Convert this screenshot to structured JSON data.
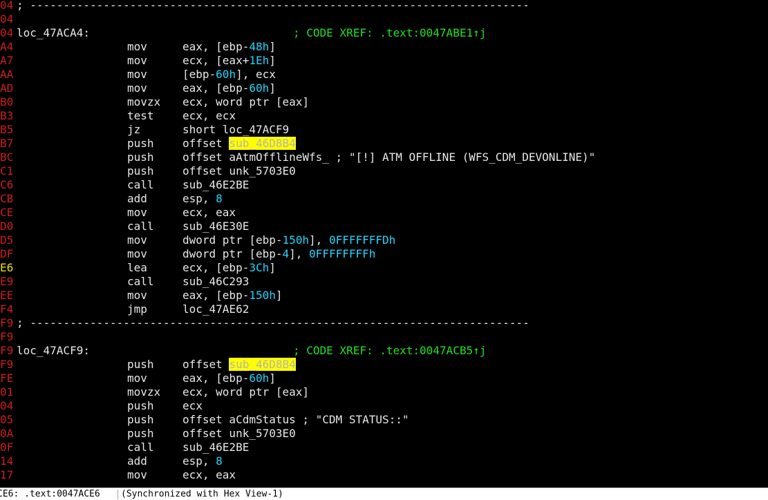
{
  "colors": {
    "background": "#000000",
    "address": "#cc1e1e",
    "current_address": "#f0e000",
    "text": "#e8e8e8",
    "xref_comment": "#22e022",
    "number": "#22d6ff",
    "highlight": "#ffff00"
  },
  "lines": [
    {
      "kind": "sep",
      "addr": "04",
      "text": "; ---------------------------------------------------------------------------"
    },
    {
      "kind": "blank",
      "addr": "04"
    },
    {
      "kind": "label",
      "addr": "04",
      "label": "loc_47ACA4:",
      "xref": "; CODE XREF: .text:0047ABE1↑j"
    },
    {
      "kind": "ins",
      "addr": "A4",
      "mnem": "mov",
      "ops": [
        {
          "t": "eax, [ebp-"
        },
        {
          "t": "48h",
          "c": "n"
        },
        {
          "t": "]"
        }
      ]
    },
    {
      "kind": "ins",
      "addr": "A7",
      "mnem": "mov",
      "ops": [
        {
          "t": "ecx, [eax+"
        },
        {
          "t": "1Eh",
          "c": "n"
        },
        {
          "t": "]"
        }
      ]
    },
    {
      "kind": "ins",
      "addr": "AA",
      "mnem": "mov",
      "ops": [
        {
          "t": "[ebp-"
        },
        {
          "t": "60h",
          "c": "n"
        },
        {
          "t": "], ecx"
        }
      ]
    },
    {
      "kind": "ins",
      "addr": "AD",
      "mnem": "mov",
      "ops": [
        {
          "t": "eax, [ebp-"
        },
        {
          "t": "60h",
          "c": "n"
        },
        {
          "t": "]"
        }
      ]
    },
    {
      "kind": "ins",
      "addr": "B0",
      "mnem": "movzx",
      "ops": [
        {
          "t": "ecx, word ptr [eax]"
        }
      ]
    },
    {
      "kind": "ins",
      "addr": "B3",
      "mnem": "test",
      "ops": [
        {
          "t": "ecx, ecx"
        }
      ]
    },
    {
      "kind": "ins",
      "addr": "B5",
      "mnem": "jz",
      "ops": [
        {
          "t": "short loc_47ACF9"
        }
      ]
    },
    {
      "kind": "ins",
      "addr": "B7",
      "mnem": "push",
      "ops": [
        {
          "t": "offset "
        },
        {
          "t": "sub_46D8B4",
          "c": "hl"
        }
      ]
    },
    {
      "kind": "ins",
      "addr": "BC",
      "mnem": "push",
      "ops": [
        {
          "t": "offset aAtmOfflineWfs_ ; \"[!] ATM OFFLINE (WFS_CDM_DEVONLINE)\""
        }
      ]
    },
    {
      "kind": "ins",
      "addr": "C1",
      "mnem": "push",
      "ops": [
        {
          "t": "offset unk_5703E0"
        }
      ]
    },
    {
      "kind": "ins",
      "addr": "C6",
      "mnem": "call",
      "ops": [
        {
          "t": "sub_46E2BE"
        }
      ]
    },
    {
      "kind": "ins",
      "addr": "CB",
      "mnem": "add",
      "ops": [
        {
          "t": "esp, "
        },
        {
          "t": "8",
          "c": "n"
        }
      ]
    },
    {
      "kind": "ins",
      "addr": "CE",
      "mnem": "mov",
      "ops": [
        {
          "t": "ecx, eax"
        }
      ]
    },
    {
      "kind": "ins",
      "addr": "D0",
      "mnem": "call",
      "ops": [
        {
          "t": "sub_46E30E"
        }
      ]
    },
    {
      "kind": "ins",
      "addr": "D5",
      "mnem": "mov",
      "ops": [
        {
          "t": "dword ptr [ebp-"
        },
        {
          "t": "150h",
          "c": "n"
        },
        {
          "t": "], "
        },
        {
          "t": "0FFFFFFFDh",
          "c": "n"
        }
      ]
    },
    {
      "kind": "ins",
      "addr": "DF",
      "mnem": "mov",
      "ops": [
        {
          "t": "dword ptr [ebp-"
        },
        {
          "t": "4",
          "c": "n"
        },
        {
          "t": "], "
        },
        {
          "t": "0FFFFFFFFh",
          "c": "n"
        }
      ]
    },
    {
      "kind": "ins",
      "addr": "E6",
      "cur": true,
      "mnem": "lea",
      "ops": [
        {
          "t": "ecx, [ebp-"
        },
        {
          "t": "3Ch",
          "c": "n"
        },
        {
          "t": "]"
        }
      ]
    },
    {
      "kind": "ins",
      "addr": "E9",
      "mnem": "call",
      "ops": [
        {
          "t": "sub_46C293"
        }
      ]
    },
    {
      "kind": "ins",
      "addr": "EE",
      "mnem": "mov",
      "ops": [
        {
          "t": "eax, [ebp-"
        },
        {
          "t": "150h",
          "c": "n"
        },
        {
          "t": "]"
        }
      ]
    },
    {
      "kind": "ins",
      "addr": "F4",
      "mnem": "jmp",
      "ops": [
        {
          "t": "loc_47AE62"
        }
      ]
    },
    {
      "kind": "sep",
      "addr": "F9",
      "text": "; ---------------------------------------------------------------------------"
    },
    {
      "kind": "blank",
      "addr": "F9"
    },
    {
      "kind": "label",
      "addr": "F9",
      "label": "loc_47ACF9:",
      "xref": "; CODE XREF: .text:0047ACB5↑j"
    },
    {
      "kind": "ins",
      "addr": "F9",
      "mnem": "push",
      "ops": [
        {
          "t": "offset "
        },
        {
          "t": "sub_46D8B4",
          "c": "hl"
        }
      ]
    },
    {
      "kind": "ins",
      "addr": "FE",
      "mnem": "mov",
      "ops": [
        {
          "t": "eax, [ebp-"
        },
        {
          "t": "60h",
          "c": "n"
        },
        {
          "t": "]"
        }
      ]
    },
    {
      "kind": "ins",
      "addr": "01",
      "mnem": "movzx",
      "ops": [
        {
          "t": "ecx, word ptr [eax]"
        }
      ]
    },
    {
      "kind": "ins",
      "addr": "04",
      "mnem": "push",
      "ops": [
        {
          "t": "ecx"
        }
      ]
    },
    {
      "kind": "ins",
      "addr": "05",
      "mnem": "push",
      "ops": [
        {
          "t": "offset aCdmStatus ; \"CDM STATUS::\""
        }
      ]
    },
    {
      "kind": "ins",
      "addr": "0A",
      "mnem": "push",
      "ops": [
        {
          "t": "offset unk_5703E0"
        }
      ]
    },
    {
      "kind": "ins",
      "addr": "0F",
      "mnem": "call",
      "ops": [
        {
          "t": "sub_46E2BE"
        }
      ]
    },
    {
      "kind": "ins",
      "addr": "14",
      "mnem": "add",
      "ops": [
        {
          "t": "esp, "
        },
        {
          "t": "8",
          "c": "n"
        }
      ]
    },
    {
      "kind": "ins",
      "addr": "17",
      "mnem": "mov",
      "ops": [
        {
          "t": "ecx, eax"
        }
      ]
    }
  ],
  "status_bar": {
    "address": "CE6: .text:0047ACE6",
    "sync": "(Synchronized with Hex View-1)"
  }
}
